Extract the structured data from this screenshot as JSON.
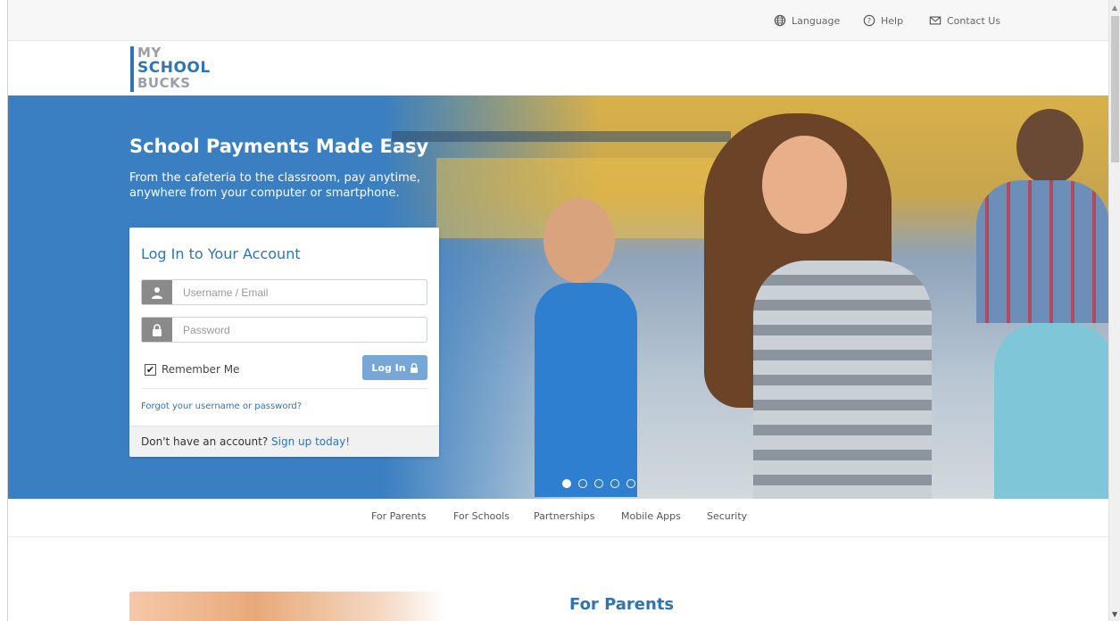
{
  "topbar": {
    "language": "Language",
    "help": "Help",
    "contact": "Contact Us"
  },
  "logo": {
    "line1": "MY",
    "line2": "SCHOOL",
    "line3": "BUCKS"
  },
  "hero": {
    "title": "School Payments Made Easy",
    "subtitle": "From the cafeteria to the classroom, pay anytime, anywhere from your computer or smartphone."
  },
  "login": {
    "title": "Log In to Your Account",
    "username_placeholder": "Username / Email",
    "password_placeholder": "Password",
    "remember_label": "Remember Me",
    "remember_checked": true,
    "button_label": "Log In",
    "forgot_label": "Forgot your username or password?",
    "no_account": "Don't have an account?",
    "signup_link": "Sign up today!"
  },
  "carousel": {
    "count": 5,
    "active": 0
  },
  "nav": {
    "items": [
      "For Parents",
      "For Schools",
      "Partnerships",
      "Mobile Apps",
      "Security"
    ]
  },
  "section": {
    "title": "For Parents"
  },
  "colors": {
    "brand_blue": "#2f74b5",
    "hero_blue": "#3a7fc1",
    "button_blue": "#77a7d6"
  }
}
